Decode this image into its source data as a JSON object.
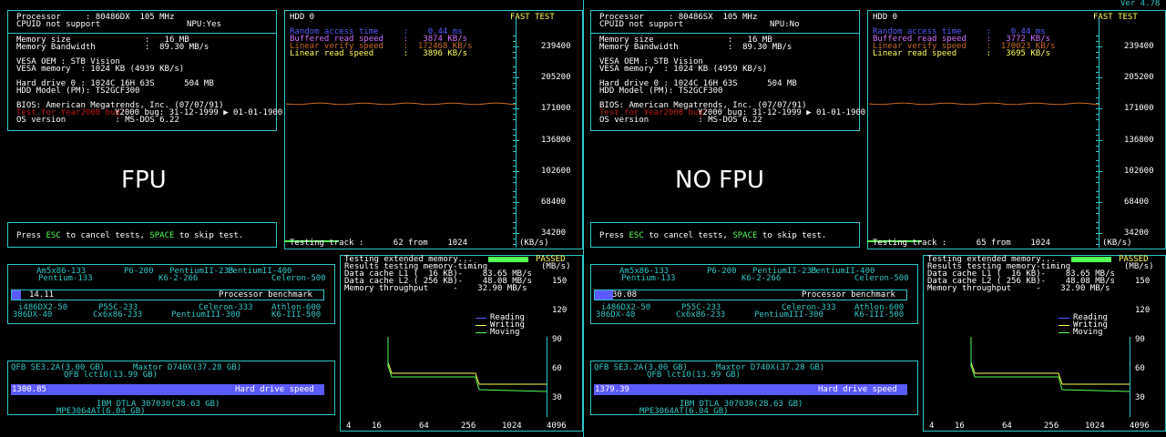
{
  "version": "Ver 4.78",
  "panels": [
    {
      "title_label": "FPU",
      "processor": "Processor     : 80486DX  105 MHz",
      "cpuid": "CPUID not support",
      "npu": "NPU:Yes",
      "mem_size": "Memory size               :   16 MB",
      "mem_bw": "Memory Bandwidth          :  89.30 MB/s",
      "vesa_oem": "VESA OEM : STB Vision",
      "vesa_mem": "VESA memory  : 1024 KB (4939 KB/s)",
      "hdd0": "Hard drive 0 : 1024C 16H 63S      504 MB",
      "hdd_model": "HDD Model (PM): TS2GCF300",
      "bios": "BIOS: American Megatrends, Inc. (07/07/91)",
      "y2k": "Y2000 bug: 31-12-1999 ▶ 01-01-1900",
      "y2k_prefix": "Test for Year2000 bug:",
      "os": "OS version          : MS-DOS 6.22",
      "esc_line": {
        "a": "Press ",
        "esc": "ESC",
        "b": " to cancel tests, ",
        "space": "SPACE",
        "c": " to skip test."
      },
      "hdd_title": "HDD 0",
      "fast_test": "FAST TEST",
      "random_access": "Random access time     :    0.44 ms",
      "buffered_read": "Buffered read speed    :   3874 KB/s",
      "linear_verify": "Linear verify speed    :  172468 KB/s",
      "linear_read": "Linear read speed      :   3896 KB/s",
      "hdd_scale": [
        "239400",
        "205200",
        "171000",
        "136800",
        "102600",
        "68400",
        "34200"
      ],
      "testing_track": "Testing track :      62 from    1024",
      "kbs": "(KB/s)",
      "cpu_bench_value": "14.11",
      "cpu_bench_label": "Processor benchmark",
      "cpu_bench_fraction": 0.028,
      "cpu_top_labels": [
        "Am5x86-133",
        "P6-200",
        "PentiumII-233",
        "PentiumII-400",
        "Pentium-133",
        "K6-2-266",
        "Celeron-500"
      ],
      "cpu_bottom_labels": [
        "i486DX2-50",
        "P55C-233",
        "Celeron-333",
        "Athlon-600",
        "386DX-40",
        "Cx6x86-233",
        "PentiumIII-300",
        "K6-III-500"
      ],
      "mem_head": "Testing extended memory...",
      "passed": "PASSED",
      "results_line": "Results testing memory-timing",
      "mbs": "(MB/s)",
      "l1": "Data cache L1 (  16 KB)-    83.65 MB/s",
      "l2": "Data cache L2 ( 256 KB)-    48.08 MB/s",
      "mt": "Memory throughput     -    32.90 MB/s",
      "mem_scale": [
        "150",
        "120",
        "90",
        "60",
        "30"
      ],
      "legend": [
        "Reading",
        "Writing",
        "Moving"
      ],
      "mem_x": [
        "4",
        "16",
        "64",
        "256",
        "1024",
        "4096"
      ],
      "hdd_top_labels": [
        "QFB SE3.2A(3.00 GB)",
        "Maxtor D740X(37.28 GB)",
        "QFB lct10(13.99 GB)"
      ],
      "hdd_bench_value": "1300.85",
      "hdd_bench_label": "Hard drive speed",
      "hdd_bottom_labels": [
        "IBM DTLA 307030(28.63 GB)",
        "MPE3064AT(6.04 GB)"
      ]
    },
    {
      "title_label": "NO FPU",
      "processor": "Processor     : 80486SX  105 MHz",
      "cpuid": "CPUID not support",
      "npu": "NPU:No",
      "mem_size": "Memory size               :   16 MB",
      "mem_bw": "Memory Bandwidth          :  89.30 MB/s",
      "vesa_oem": "VESA OEM : STB Vision",
      "vesa_mem": "VESA memory  : 1024 KB (4959 KB/s)",
      "hdd0": "Hard drive 0 : 1024C 16H 63S      504 MB",
      "hdd_model": "HDD Model (PM): TS2GCF300",
      "bios": "BIOS: American Megatrends, Inc. (07/07/91)",
      "y2k": "Y2000 bug: 31-12-1999 ▶ 01-01-1900",
      "y2k_prefix": "Test for Year2000 bug:",
      "os": "OS version          : MS-DOS 6.22",
      "esc_line": {
        "a": "Press ",
        "esc": "ESC",
        "b": " to cancel tests, ",
        "space": "SPACE",
        "c": " to skip test."
      },
      "hdd_title": "HDD 0",
      "fast_test": "FAST TEST",
      "random_access": "Random access time     :    0.44 ms",
      "buffered_read": "Buffered read speed    :   3772 KB/s",
      "linear_verify": "Linear verify speed    :  170023 KB/s",
      "linear_read": "Linear read speed      :   3695 KB/s",
      "hdd_scale": [
        "239400",
        "205200",
        "171000",
        "136800",
        "102600",
        "68400",
        "34200"
      ],
      "testing_track": "Testing track :      65 from    1024",
      "kbs": "(KB/s)",
      "cpu_bench_value": "30.08",
      "cpu_bench_label": "Processor benchmark",
      "cpu_bench_fraction": 0.058,
      "cpu_top_labels": [
        "Am5x86-133",
        "P6-200",
        "PentiumII-233",
        "PentiumII-400",
        "Pentium-133",
        "K6-2-266",
        "Celeron-500"
      ],
      "cpu_bottom_labels": [
        "i486DX2-50",
        "P55C-233",
        "Celeron-333",
        "Athlon-600",
        "386DX-40",
        "Cx6x86-233",
        "PentiumIII-300",
        "K6-III-500"
      ],
      "mem_head": "Testing extended memory...",
      "passed": "PASSED",
      "results_line": "Results testing memory-timing",
      "mbs": "(MB/s)",
      "l1": "Data cache L1 (  16 KB)-    83.65 MB/s",
      "l2": "Data cache L2 ( 256 KB)-    48.08 MB/s",
      "mt": "Memory throughput     -    32.90 MB/s",
      "mem_scale": [
        "150",
        "120",
        "90",
        "60",
        "30"
      ],
      "legend": [
        "Reading",
        "Writing",
        "Moving"
      ],
      "mem_x": [
        "4",
        "16",
        "64",
        "256",
        "1024",
        "4096"
      ],
      "hdd_top_labels": [
        "QFB SE3.2A(3.00 GB)",
        "Maxtor D740X(37.28 GB)",
        "QFB lct10(13.99 GB)"
      ],
      "hdd_bench_value": "1379.39",
      "hdd_bench_label": "Hard drive speed",
      "hdd_bottom_labels": [
        "IBM DTLA 307030(28.63 GB)",
        "MPE3064AT(6.04 GB)"
      ]
    }
  ]
}
